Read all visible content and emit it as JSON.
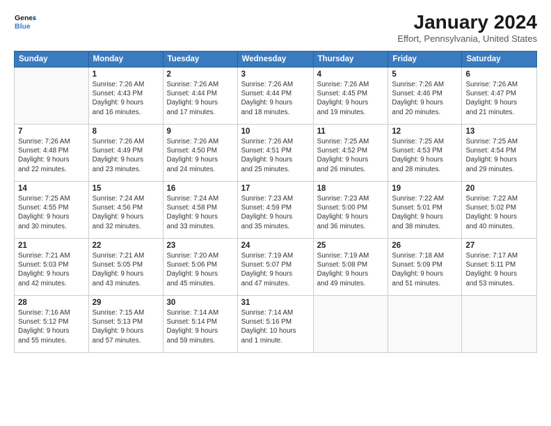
{
  "logo": {
    "line1": "General",
    "line2": "Blue"
  },
  "title": "January 2024",
  "location": "Effort, Pennsylvania, United States",
  "weekdays": [
    "Sunday",
    "Monday",
    "Tuesday",
    "Wednesday",
    "Thursday",
    "Friday",
    "Saturday"
  ],
  "weeks": [
    [
      {
        "day": "",
        "info": ""
      },
      {
        "day": "1",
        "info": "Sunrise: 7:26 AM\nSunset: 4:43 PM\nDaylight: 9 hours\nand 16 minutes."
      },
      {
        "day": "2",
        "info": "Sunrise: 7:26 AM\nSunset: 4:44 PM\nDaylight: 9 hours\nand 17 minutes."
      },
      {
        "day": "3",
        "info": "Sunrise: 7:26 AM\nSunset: 4:44 PM\nDaylight: 9 hours\nand 18 minutes."
      },
      {
        "day": "4",
        "info": "Sunrise: 7:26 AM\nSunset: 4:45 PM\nDaylight: 9 hours\nand 19 minutes."
      },
      {
        "day": "5",
        "info": "Sunrise: 7:26 AM\nSunset: 4:46 PM\nDaylight: 9 hours\nand 20 minutes."
      },
      {
        "day": "6",
        "info": "Sunrise: 7:26 AM\nSunset: 4:47 PM\nDaylight: 9 hours\nand 21 minutes."
      }
    ],
    [
      {
        "day": "7",
        "info": "Sunrise: 7:26 AM\nSunset: 4:48 PM\nDaylight: 9 hours\nand 22 minutes."
      },
      {
        "day": "8",
        "info": "Sunrise: 7:26 AM\nSunset: 4:49 PM\nDaylight: 9 hours\nand 23 minutes."
      },
      {
        "day": "9",
        "info": "Sunrise: 7:26 AM\nSunset: 4:50 PM\nDaylight: 9 hours\nand 24 minutes."
      },
      {
        "day": "10",
        "info": "Sunrise: 7:26 AM\nSunset: 4:51 PM\nDaylight: 9 hours\nand 25 minutes."
      },
      {
        "day": "11",
        "info": "Sunrise: 7:25 AM\nSunset: 4:52 PM\nDaylight: 9 hours\nand 26 minutes."
      },
      {
        "day": "12",
        "info": "Sunrise: 7:25 AM\nSunset: 4:53 PM\nDaylight: 9 hours\nand 28 minutes."
      },
      {
        "day": "13",
        "info": "Sunrise: 7:25 AM\nSunset: 4:54 PM\nDaylight: 9 hours\nand 29 minutes."
      }
    ],
    [
      {
        "day": "14",
        "info": "Sunrise: 7:25 AM\nSunset: 4:55 PM\nDaylight: 9 hours\nand 30 minutes."
      },
      {
        "day": "15",
        "info": "Sunrise: 7:24 AM\nSunset: 4:56 PM\nDaylight: 9 hours\nand 32 minutes."
      },
      {
        "day": "16",
        "info": "Sunrise: 7:24 AM\nSunset: 4:58 PM\nDaylight: 9 hours\nand 33 minutes."
      },
      {
        "day": "17",
        "info": "Sunrise: 7:23 AM\nSunset: 4:59 PM\nDaylight: 9 hours\nand 35 minutes."
      },
      {
        "day": "18",
        "info": "Sunrise: 7:23 AM\nSunset: 5:00 PM\nDaylight: 9 hours\nand 36 minutes."
      },
      {
        "day": "19",
        "info": "Sunrise: 7:22 AM\nSunset: 5:01 PM\nDaylight: 9 hours\nand 38 minutes."
      },
      {
        "day": "20",
        "info": "Sunrise: 7:22 AM\nSunset: 5:02 PM\nDaylight: 9 hours\nand 40 minutes."
      }
    ],
    [
      {
        "day": "21",
        "info": "Sunrise: 7:21 AM\nSunset: 5:03 PM\nDaylight: 9 hours\nand 42 minutes."
      },
      {
        "day": "22",
        "info": "Sunrise: 7:21 AM\nSunset: 5:05 PM\nDaylight: 9 hours\nand 43 minutes."
      },
      {
        "day": "23",
        "info": "Sunrise: 7:20 AM\nSunset: 5:06 PM\nDaylight: 9 hours\nand 45 minutes."
      },
      {
        "day": "24",
        "info": "Sunrise: 7:19 AM\nSunset: 5:07 PM\nDaylight: 9 hours\nand 47 minutes."
      },
      {
        "day": "25",
        "info": "Sunrise: 7:19 AM\nSunset: 5:08 PM\nDaylight: 9 hours\nand 49 minutes."
      },
      {
        "day": "26",
        "info": "Sunrise: 7:18 AM\nSunset: 5:09 PM\nDaylight: 9 hours\nand 51 minutes."
      },
      {
        "day": "27",
        "info": "Sunrise: 7:17 AM\nSunset: 5:11 PM\nDaylight: 9 hours\nand 53 minutes."
      }
    ],
    [
      {
        "day": "28",
        "info": "Sunrise: 7:16 AM\nSunset: 5:12 PM\nDaylight: 9 hours\nand 55 minutes."
      },
      {
        "day": "29",
        "info": "Sunrise: 7:15 AM\nSunset: 5:13 PM\nDaylight: 9 hours\nand 57 minutes."
      },
      {
        "day": "30",
        "info": "Sunrise: 7:14 AM\nSunset: 5:14 PM\nDaylight: 9 hours\nand 59 minutes."
      },
      {
        "day": "31",
        "info": "Sunrise: 7:14 AM\nSunset: 5:16 PM\nDaylight: 10 hours\nand 1 minute."
      },
      {
        "day": "",
        "info": ""
      },
      {
        "day": "",
        "info": ""
      },
      {
        "day": "",
        "info": ""
      }
    ]
  ]
}
